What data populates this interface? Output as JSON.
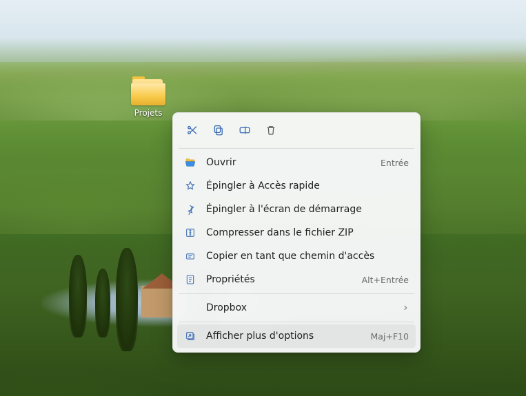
{
  "desktop": {
    "folder_label": "Projets"
  },
  "context_menu": {
    "quick_actions": {
      "cut": "cut",
      "copy": "copy",
      "rename": "rename",
      "delete": "delete"
    },
    "items": {
      "open": {
        "label": "Ouvrir",
        "accel": "Entrée"
      },
      "pin_quick_access": {
        "label": "Épingler à Accès rapide"
      },
      "pin_start": {
        "label": "Épingler à l'écran de démarrage"
      },
      "compress_zip": {
        "label": "Compresser dans le fichier ZIP"
      },
      "copy_as_path": {
        "label": "Copier en tant que chemin d'accès"
      },
      "properties": {
        "label": "Propriétés",
        "accel": "Alt+Entrée"
      },
      "dropbox": {
        "label": "Dropbox",
        "has_submenu": true
      },
      "more_options": {
        "label": "Afficher plus d'options",
        "accel": "Maj+F10"
      }
    }
  },
  "colors": {
    "accent": "#0067c0",
    "icon_stroke": "#3e6db5"
  }
}
